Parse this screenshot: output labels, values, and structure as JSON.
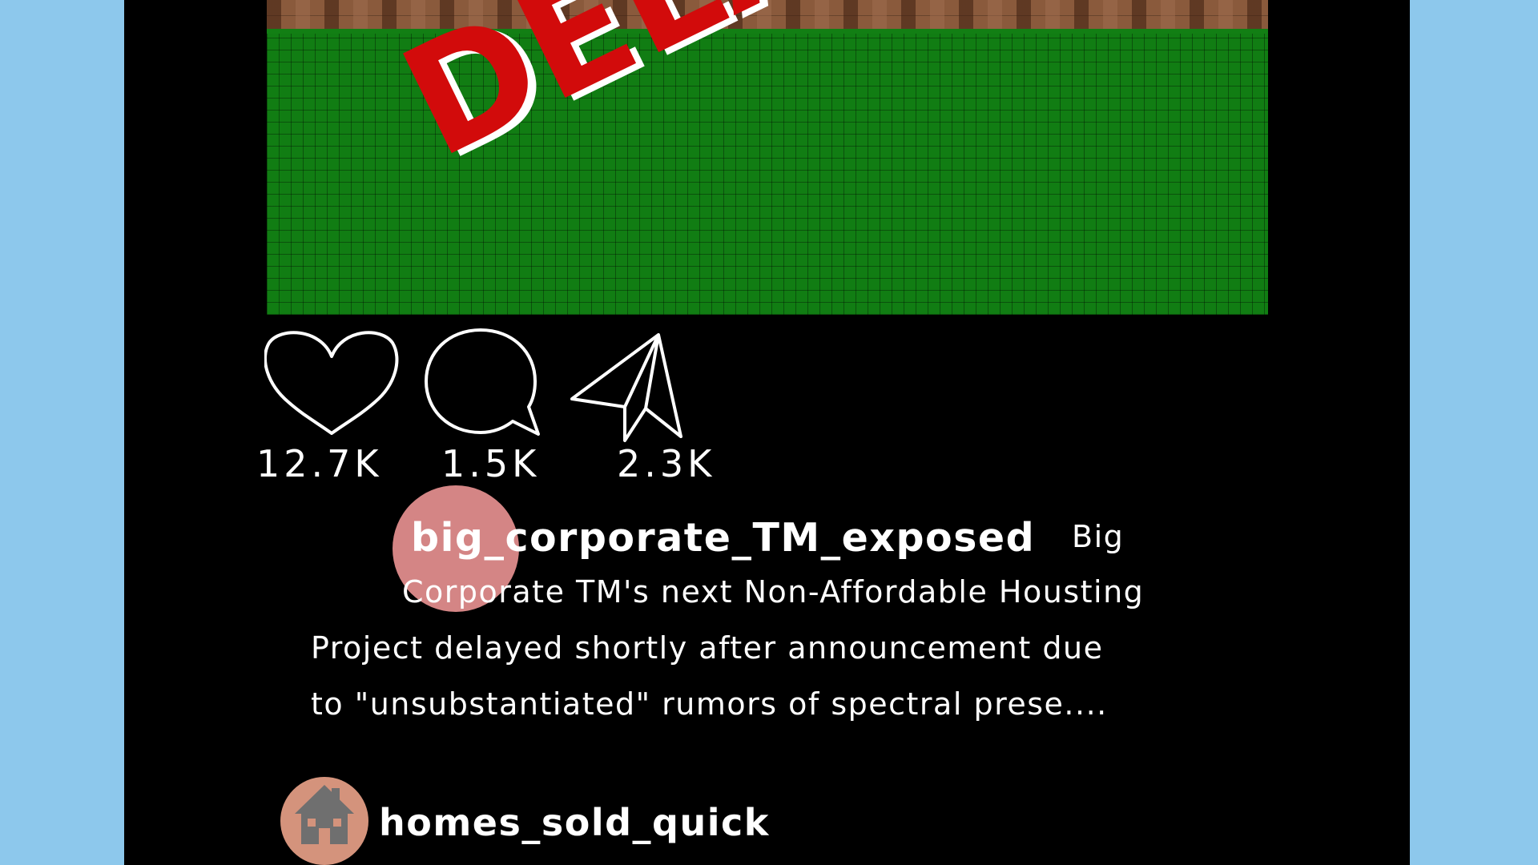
{
  "post": {
    "stamp_text": "DELAYED",
    "likes": "12.7K",
    "comments": "1.5K",
    "shares": "2.3K",
    "username": "big_corporate_TM_exposed",
    "caption_lines": [
      "Big",
      "Corporate TM's next Non-Affordable Housting",
      "Project delayed shortly after announcement due",
      "to \"unsubstantiated\" rumors of spectral prese...."
    ]
  },
  "next_post": {
    "username": "homes_sold_quick"
  },
  "colors": {
    "page_background": "#8dc8ec",
    "feed_background": "#000000",
    "stamp_red": "#d20b0b",
    "grass_green": "#117d13",
    "avatar_pink": "#d48585",
    "avatar_peach": "#d4937c"
  },
  "icons": [
    "heart-icon",
    "comment-bubble-icon",
    "paper-plane-icon",
    "house-icon"
  ]
}
